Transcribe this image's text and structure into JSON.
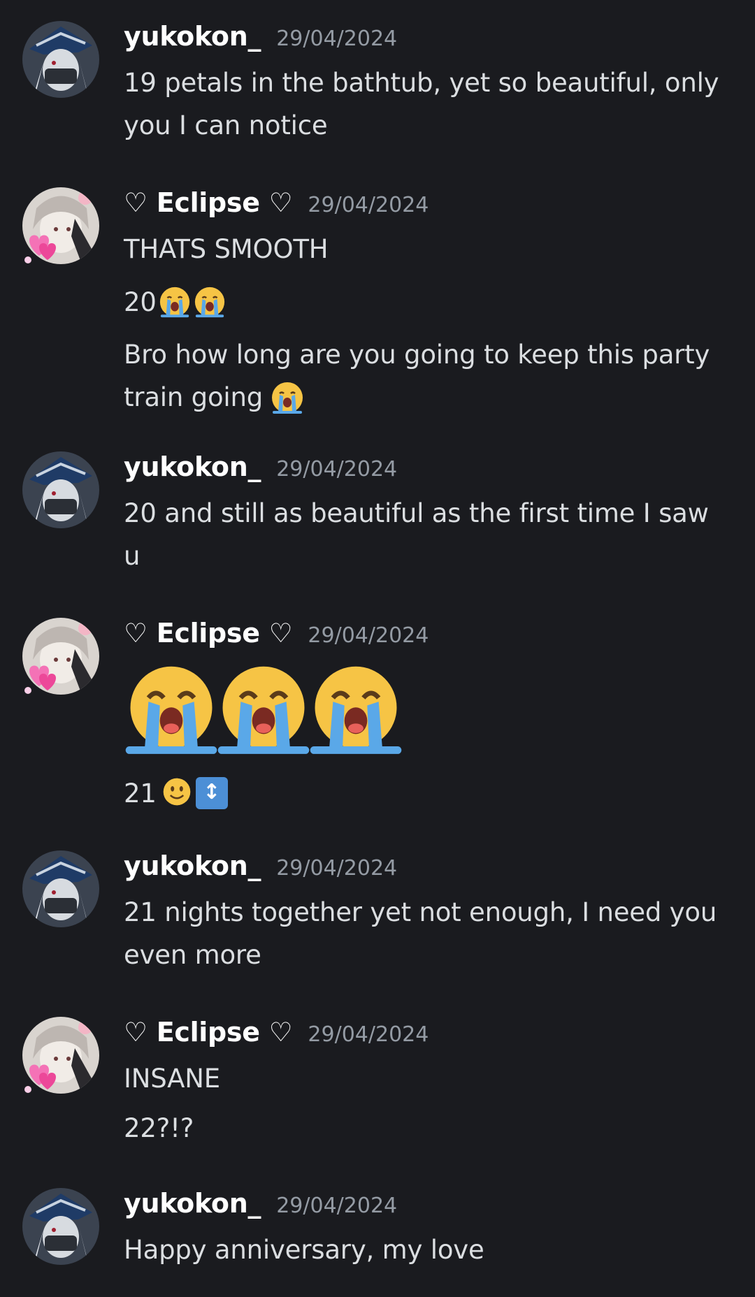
{
  "users": {
    "yukokon": {
      "display_name": "yukokon_"
    },
    "eclipse": {
      "display_name": "♡ Eclipse ♡"
    }
  },
  "messages": [
    {
      "author": "yukokon_",
      "timestamp": "29/04/2024",
      "lines": [
        "19 petals in the bathtub, yet so beautiful, only",
        "you I can notice"
      ]
    },
    {
      "author": "♡ Eclipse ♡",
      "timestamp": "29/04/2024",
      "lines": [
        "THATS SMOOTH",
        "20",
        "Bro how long are you going to keep this party",
        "train going"
      ]
    },
    {
      "author": "yukokon_",
      "timestamp": "29/04/2024",
      "lines": [
        "20 and still as beautiful as the first time I saw",
        "u"
      ]
    },
    {
      "author": "♡ Eclipse ♡",
      "timestamp": "29/04/2024",
      "lines": [
        "21"
      ]
    },
    {
      "author": "yukokon_",
      "timestamp": "29/04/2024",
      "lines": [
        "21 nights together yet not enough, I need you",
        "even more"
      ]
    },
    {
      "author": "♡ Eclipse ♡",
      "timestamp": "29/04/2024",
      "lines": [
        "INSANE",
        "22?!?"
      ]
    },
    {
      "author": "yukokon_",
      "timestamp": "29/04/2024",
      "lines": [
        "Happy anniversary, my love"
      ]
    }
  ],
  "icons": {
    "cry": "loudly-crying-face-emoji",
    "smile": "slightly-smiling-face-emoji",
    "updown": "up-down-arrow-emoji"
  },
  "colors": {
    "background": "#1a1b1f",
    "username": "#ffffff",
    "timestamp": "#949ba4",
    "text": "#dbdee1"
  }
}
